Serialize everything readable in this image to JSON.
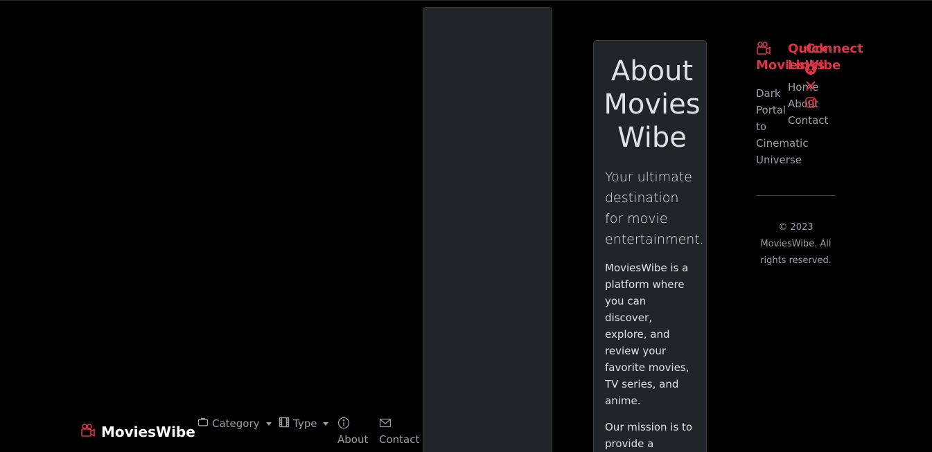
{
  "navbar": {
    "brand": "MoviesWibe",
    "items": [
      {
        "label": "Category",
        "icon": "tv-icon"
      },
      {
        "label": "Type",
        "icon": "film-icon"
      },
      {
        "label": "About",
        "icon": "info-circle-icon"
      },
      {
        "label": "Contact",
        "icon": "envelope-icon"
      }
    ]
  },
  "about": {
    "title": "About Movies Wibe",
    "lead": "Your ultimate destination for movie entertainment.",
    "paragraph1": "MoviesWibe is a platform where you can discover, explore, and review your favorite movies, TV series, and anime.",
    "paragraph2": "Our mission is to provide a comprehensive"
  },
  "footer": {
    "brand": "MoviesWibe",
    "tagline": "Dark Portal to Cinematic Universe",
    "quick_links_title": "Quick Links",
    "quick_links": [
      "Home",
      "About",
      "Contact"
    ],
    "connect_title": "Connect",
    "social": [
      "github-icon",
      "x-icon",
      "instagram-icon"
    ],
    "copyright": "© 2023 MoviesWibe. All rights reserved."
  },
  "colors": {
    "accent": "#dc3545",
    "card": "#212529",
    "background": "#000000",
    "muted": "#9aa0a6"
  }
}
